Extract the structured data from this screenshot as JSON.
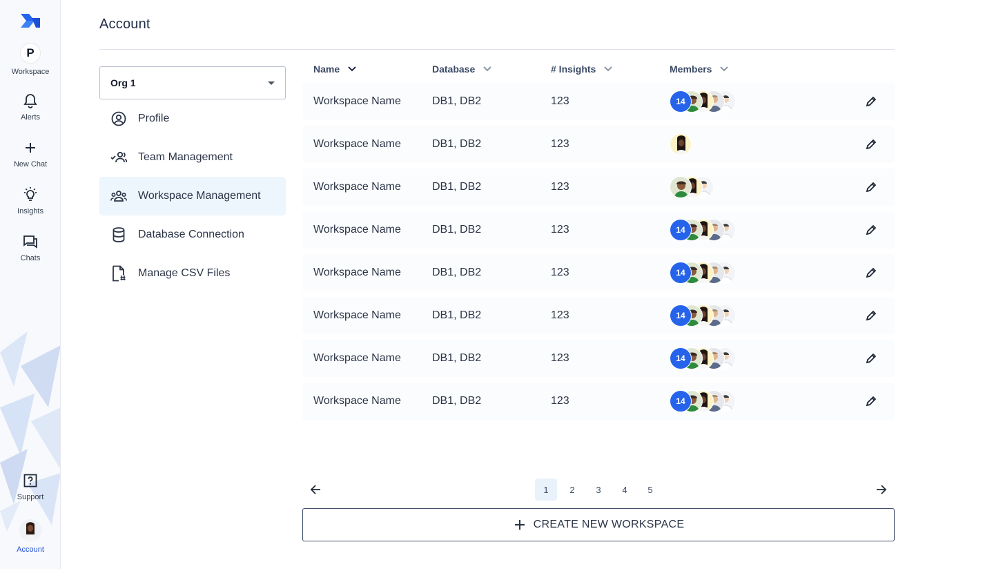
{
  "rail": {
    "logo": "brand-logo",
    "items": [
      {
        "label": "Workspace",
        "icon": "workspace-badge",
        "badge": "P"
      },
      {
        "label": "Alerts",
        "icon": "bell-icon"
      },
      {
        "label": "New Chat",
        "icon": "plus-icon"
      },
      {
        "label": "Insights",
        "icon": "lightbulb-icon"
      },
      {
        "label": "Chats",
        "icon": "chat-icon"
      },
      {
        "label": "Support",
        "icon": "help-icon"
      },
      {
        "label": "Account",
        "icon": "user-avatar"
      }
    ]
  },
  "header": {
    "title": "Account"
  },
  "org_select": {
    "value": "Org 1"
  },
  "menu": [
    {
      "label": "Profile",
      "icon": "user-circle-icon"
    },
    {
      "label": "Team Management",
      "icon": "team-icon"
    },
    {
      "label": "Workspace Management",
      "icon": "group-icon",
      "active": true
    },
    {
      "label": "Database Connection",
      "icon": "database-icon"
    },
    {
      "label": "Manage CSV Files",
      "icon": "file-icon"
    }
  ],
  "table": {
    "columns": [
      "Name",
      "Database",
      "# Insights",
      "Members"
    ],
    "rows": [
      {
        "name": "Workspace Name",
        "database": "DB1, DB2",
        "insights": "123",
        "member_count": "14",
        "members": 4
      },
      {
        "name": "Workspace Name",
        "database": "DB1, DB2",
        "insights": "123",
        "member_count": "",
        "members": 1
      },
      {
        "name": "Workspace Name",
        "database": "DB1, DB2",
        "insights": "123",
        "member_count": "",
        "members": 3
      },
      {
        "name": "Workspace Name",
        "database": "DB1, DB2",
        "insights": "123",
        "member_count": "14",
        "members": 4
      },
      {
        "name": "Workspace Name",
        "database": "DB1, DB2",
        "insights": "123",
        "member_count": "14",
        "members": 4
      },
      {
        "name": "Workspace Name",
        "database": "DB1, DB2",
        "insights": "123",
        "member_count": "14",
        "members": 4
      },
      {
        "name": "Workspace Name",
        "database": "DB1, DB2",
        "insights": "123",
        "member_count": "14",
        "members": 4
      },
      {
        "name": "Workspace Name",
        "database": "DB1, DB2",
        "insights": "123",
        "member_count": "14",
        "members": 4
      }
    ]
  },
  "pagination": {
    "pages": [
      "1",
      "2",
      "3",
      "4",
      "5"
    ],
    "current": "1"
  },
  "create_button": {
    "label": "CREATE NEW WORKSPACE"
  },
  "colors": {
    "accent": "#2563eb",
    "active_bg": "#edf5fd",
    "text": "#2b3446"
  }
}
